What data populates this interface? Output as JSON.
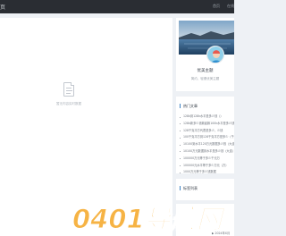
{
  "header": {
    "logo": "页",
    "nav": [
      "首页",
      "在线"
    ]
  },
  "main": {
    "empty_text": "暂无内容实时数据"
  },
  "profile": {
    "name": "优美主题",
    "desc": "简约，轻便优美主题"
  },
  "hot_articles": {
    "title": "热门文章",
    "items": [
      "128k到128k水平是多少钱（）",
      "128k新多少钱款起款100k水平是多少钱",
      "128千克平方代表是多少，少钱",
      "100千克平方到128千克平方是多少（千克）",
      "10100到水平120万元数据多少钱（大连）",
      "10100万元数据到水平是多少钱（大连）",
      "100000万元等于多少千元万",
      "100000元水平等于多少万元（万）",
      "1000万元等于多少钱数据",
      "1000亿等于多少万元钱可以是多少钱"
    ]
  },
  "tags": {
    "title": "标签列表"
  },
  "footer": {
    "date": "▶ 2024年X月"
  },
  "watermark": {
    "text": "0401导航网"
  },
  "colors": {
    "topbar": "#2a2d33",
    "accent": "#3b82c4",
    "watermark": "#f5a623"
  }
}
